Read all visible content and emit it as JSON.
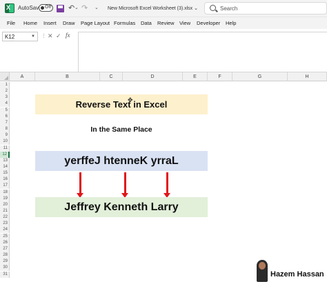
{
  "titlebar": {
    "autosave_label": "AutoSave",
    "autosave_state": "Off",
    "document_title": "New Microsoft Excel Worksheet (3).xlsx",
    "title_caret": "⌄",
    "search_placeholder": "Search",
    "undo_glyph": "↶",
    "redo_glyph": "↷"
  },
  "menu": {
    "items": [
      "File",
      "Home",
      "Insert",
      "Draw",
      "Page Layout",
      "Formulas",
      "Data",
      "Review",
      "View",
      "Developer",
      "Help"
    ]
  },
  "formula_bar": {
    "name_box": "K12",
    "fx_label": "fx",
    "formula": ""
  },
  "grid": {
    "columns": [
      "A",
      "B",
      "C",
      "D",
      "E",
      "F",
      "G",
      "H"
    ],
    "rows": [
      "1",
      "2",
      "3",
      "4",
      "5",
      "6",
      "7",
      "8",
      "9",
      "10",
      "11",
      "12",
      "13",
      "14",
      "15",
      "16",
      "17",
      "18",
      "19",
      "20",
      "21",
      "22",
      "23",
      "24",
      "25",
      "26",
      "27",
      "28",
      "29",
      "30",
      "31"
    ],
    "active_row": "12"
  },
  "sheet": {
    "title": "Reverse Text in Excel",
    "subtitle": "In the Same Place",
    "reversed_text": "yerffeJ htenneK yrraL",
    "result_text": "Jeffrey Kenneth Larry"
  },
  "watermark": {
    "text": "Hazem Hassan"
  },
  "colors": {
    "excel_green": "#1d6f42",
    "title_fill": "#fdf0cc",
    "reversed_fill": "#d9e2f3",
    "result_fill": "#e2efd9",
    "arrow": "#e0161a"
  }
}
